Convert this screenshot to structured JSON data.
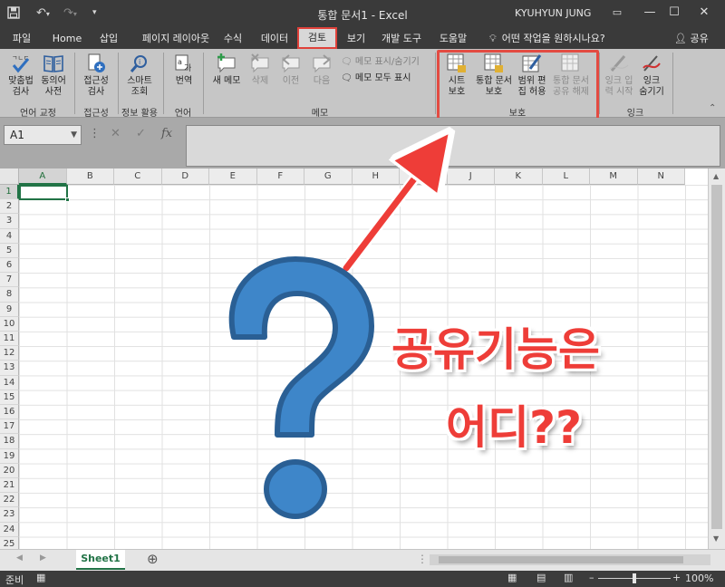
{
  "titlebar": {
    "title": "통합 문서1  -  Excel",
    "user": "KYUHYUN JUNG",
    "icons": [
      "save-icon",
      "undo-icon",
      "redo-icon",
      "customize-qat-icon",
      "ribbon-display-icon",
      "minimize-icon",
      "restore-icon",
      "close-icon"
    ]
  },
  "tabs": [
    {
      "label": "파일"
    },
    {
      "label": "Home"
    },
    {
      "label": "삽입"
    },
    {
      "label": "페이지 레이아웃"
    },
    {
      "label": "수식"
    },
    {
      "label": "데이터"
    },
    {
      "label": "검토",
      "active": true
    },
    {
      "label": "보기"
    },
    {
      "label": "개발 도구"
    },
    {
      "label": "도움말"
    }
  ],
  "tell_me": "어떤 작업을 원하시나요?",
  "share": "공유",
  "ribbon": {
    "proofing": {
      "spell": [
        "맞춤법",
        "검사"
      ],
      "thesaurus": [
        "동의어",
        "사전"
      ],
      "label": "언어 교정"
    },
    "accessibility": {
      "check": [
        "접근성",
        "검사"
      ],
      "label": "접근성"
    },
    "insights": {
      "smart": [
        "스마트",
        "조회"
      ],
      "label": "정보 활용"
    },
    "language": {
      "translate": [
        "번역"
      ],
      "label": "언어"
    },
    "comments": {
      "new": [
        "새 메모"
      ],
      "delete": [
        "삭제"
      ],
      "prev": [
        "이전"
      ],
      "next": [
        "다음"
      ],
      "show_hide": "메모 표시/숨기기",
      "show_all": "메모 모두 표시",
      "label": "메모"
    },
    "protect": {
      "sheet": [
        "시트",
        "보호"
      ],
      "workbook": [
        "통합 문서",
        "보호"
      ],
      "ranges": [
        "범위 편",
        "집 허용"
      ],
      "unshare": [
        "통합 문서",
        "공유 해제"
      ],
      "label": "보호"
    },
    "ink": {
      "start": [
        "잉크 입",
        "력 시작"
      ],
      "hide": [
        "잉크",
        "숨기기"
      ],
      "label": "잉크"
    }
  },
  "formula_bar": {
    "name_box": "A1",
    "fx": "fx",
    "cancel": "✕",
    "enter": "✓",
    "more": "⋮"
  },
  "grid": {
    "columns": [
      "A",
      "B",
      "C",
      "D",
      "E",
      "F",
      "G",
      "H",
      "I",
      "J",
      "K",
      "L",
      "M",
      "N"
    ],
    "rows": [
      "1",
      "2",
      "3",
      "4",
      "5",
      "6",
      "7",
      "8",
      "9",
      "10",
      "11",
      "12",
      "13",
      "14",
      "15",
      "16",
      "17",
      "18",
      "19",
      "20",
      "21",
      "22",
      "23",
      "24",
      "25"
    ],
    "active_cell": "A1"
  },
  "sheets": [
    {
      "name": "Sheet1",
      "active": true
    }
  ],
  "status": {
    "ready": "준비",
    "zoom": "100%"
  },
  "overlay": {
    "line1": "공유기능은",
    "line2": "어디??"
  },
  "colors": {
    "title_bg": "#3a3a3a",
    "ribbon_bg": "#c6c6c6",
    "accent_green": "#217346",
    "highlight_red": "#e34b42",
    "question_blue": "#3e86c9"
  }
}
